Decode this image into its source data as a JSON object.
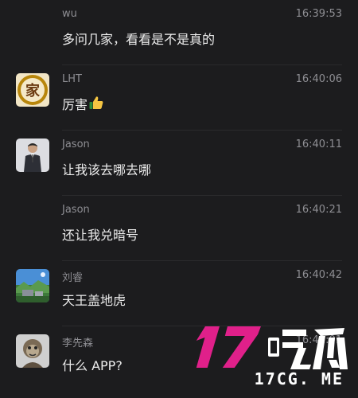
{
  "messages": [
    {
      "sender": "wu",
      "time": "16:39:53",
      "text": "多问几家，看看是不是真的",
      "avatar": null
    },
    {
      "sender": "LHT",
      "time": "16:40:06",
      "text": "厉害",
      "emoji": "thumbs-up",
      "avatar": "jia-seal"
    },
    {
      "sender": "Jason",
      "time": "16:40:11",
      "text": "让我该去哪去哪",
      "avatar": "man-in-suit"
    },
    {
      "sender": "Jason",
      "time": "16:40:21",
      "text": "还让我兑暗号",
      "avatar": null
    },
    {
      "sender": "刘睿",
      "time": "16:40:42",
      "text": "天王盖地虎",
      "avatar": "landscape-photo"
    },
    {
      "sender": "李先森",
      "time": "16:41:01",
      "text": "什么 APP?",
      "avatar": "monkey-photo"
    }
  ],
  "watermark": {
    "logo_text": "17吃瓜",
    "url": "17CG. ME",
    "colors": {
      "digits": "#e0208a",
      "chars": "#ffffff"
    }
  },
  "colors": {
    "background": "#1c1c1e",
    "text_primary": "#ececec",
    "text_secondary": "#8e8e93",
    "divider": "#2a2a2c"
  }
}
